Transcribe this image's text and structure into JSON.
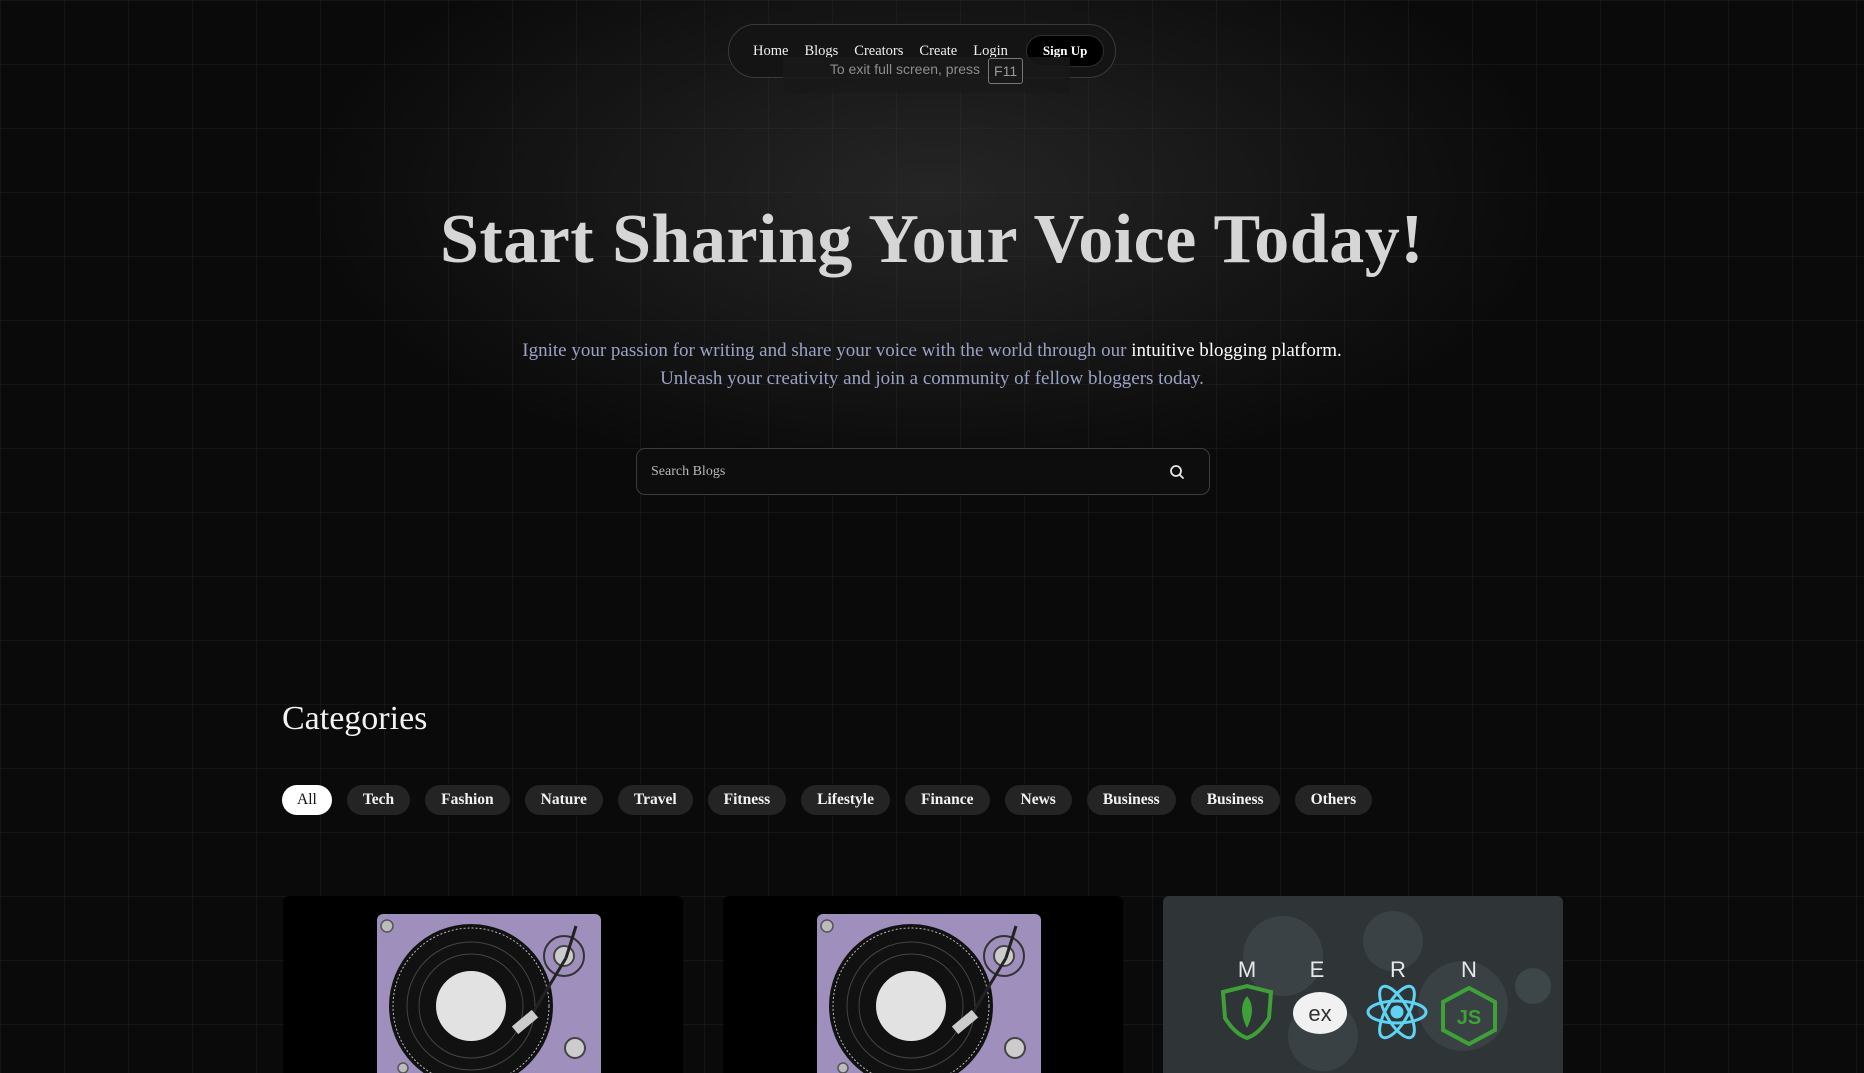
{
  "nav": {
    "links": [
      "Home",
      "Blogs",
      "Creators",
      "Create",
      "Login"
    ],
    "signup_label": "Sign Up"
  },
  "fullscreen_toast": {
    "message": "To exit full screen, press",
    "key": "F11"
  },
  "hero": {
    "title": "Start Sharing Your Voice Today!",
    "desc_part1": "Ignite your passion for writing and share your voice with the world through our ",
    "desc_highlight": "intuitive blogging platform.",
    "desc_part2": " Unleash your creativity and join a community of fellow bloggers today."
  },
  "search": {
    "placeholder": "Search Blogs",
    "icon": "search-icon"
  },
  "categories": {
    "title": "Categories",
    "chips": [
      "All",
      "Tech",
      "Fashion",
      "Nature",
      "Travel",
      "Fitness",
      "Lifestyle",
      "Finance",
      "News",
      "Business",
      "Business",
      "Others"
    ],
    "active": "All"
  },
  "cards": [
    {
      "image": "turntable-image"
    },
    {
      "image": "turntable-image"
    },
    {
      "image": "mern-stack-image",
      "letters": [
        "M",
        "E",
        "R",
        "N"
      ],
      "express_text": "ex"
    }
  ],
  "colors": {
    "background": "#0a0a0a",
    "hero_title": "#d6d6d6",
    "hero_desc": "#9aa3c4",
    "chip_bg": "#242424",
    "chip_active_bg": "#ffffff",
    "turntable": "#9f8fbd"
  }
}
